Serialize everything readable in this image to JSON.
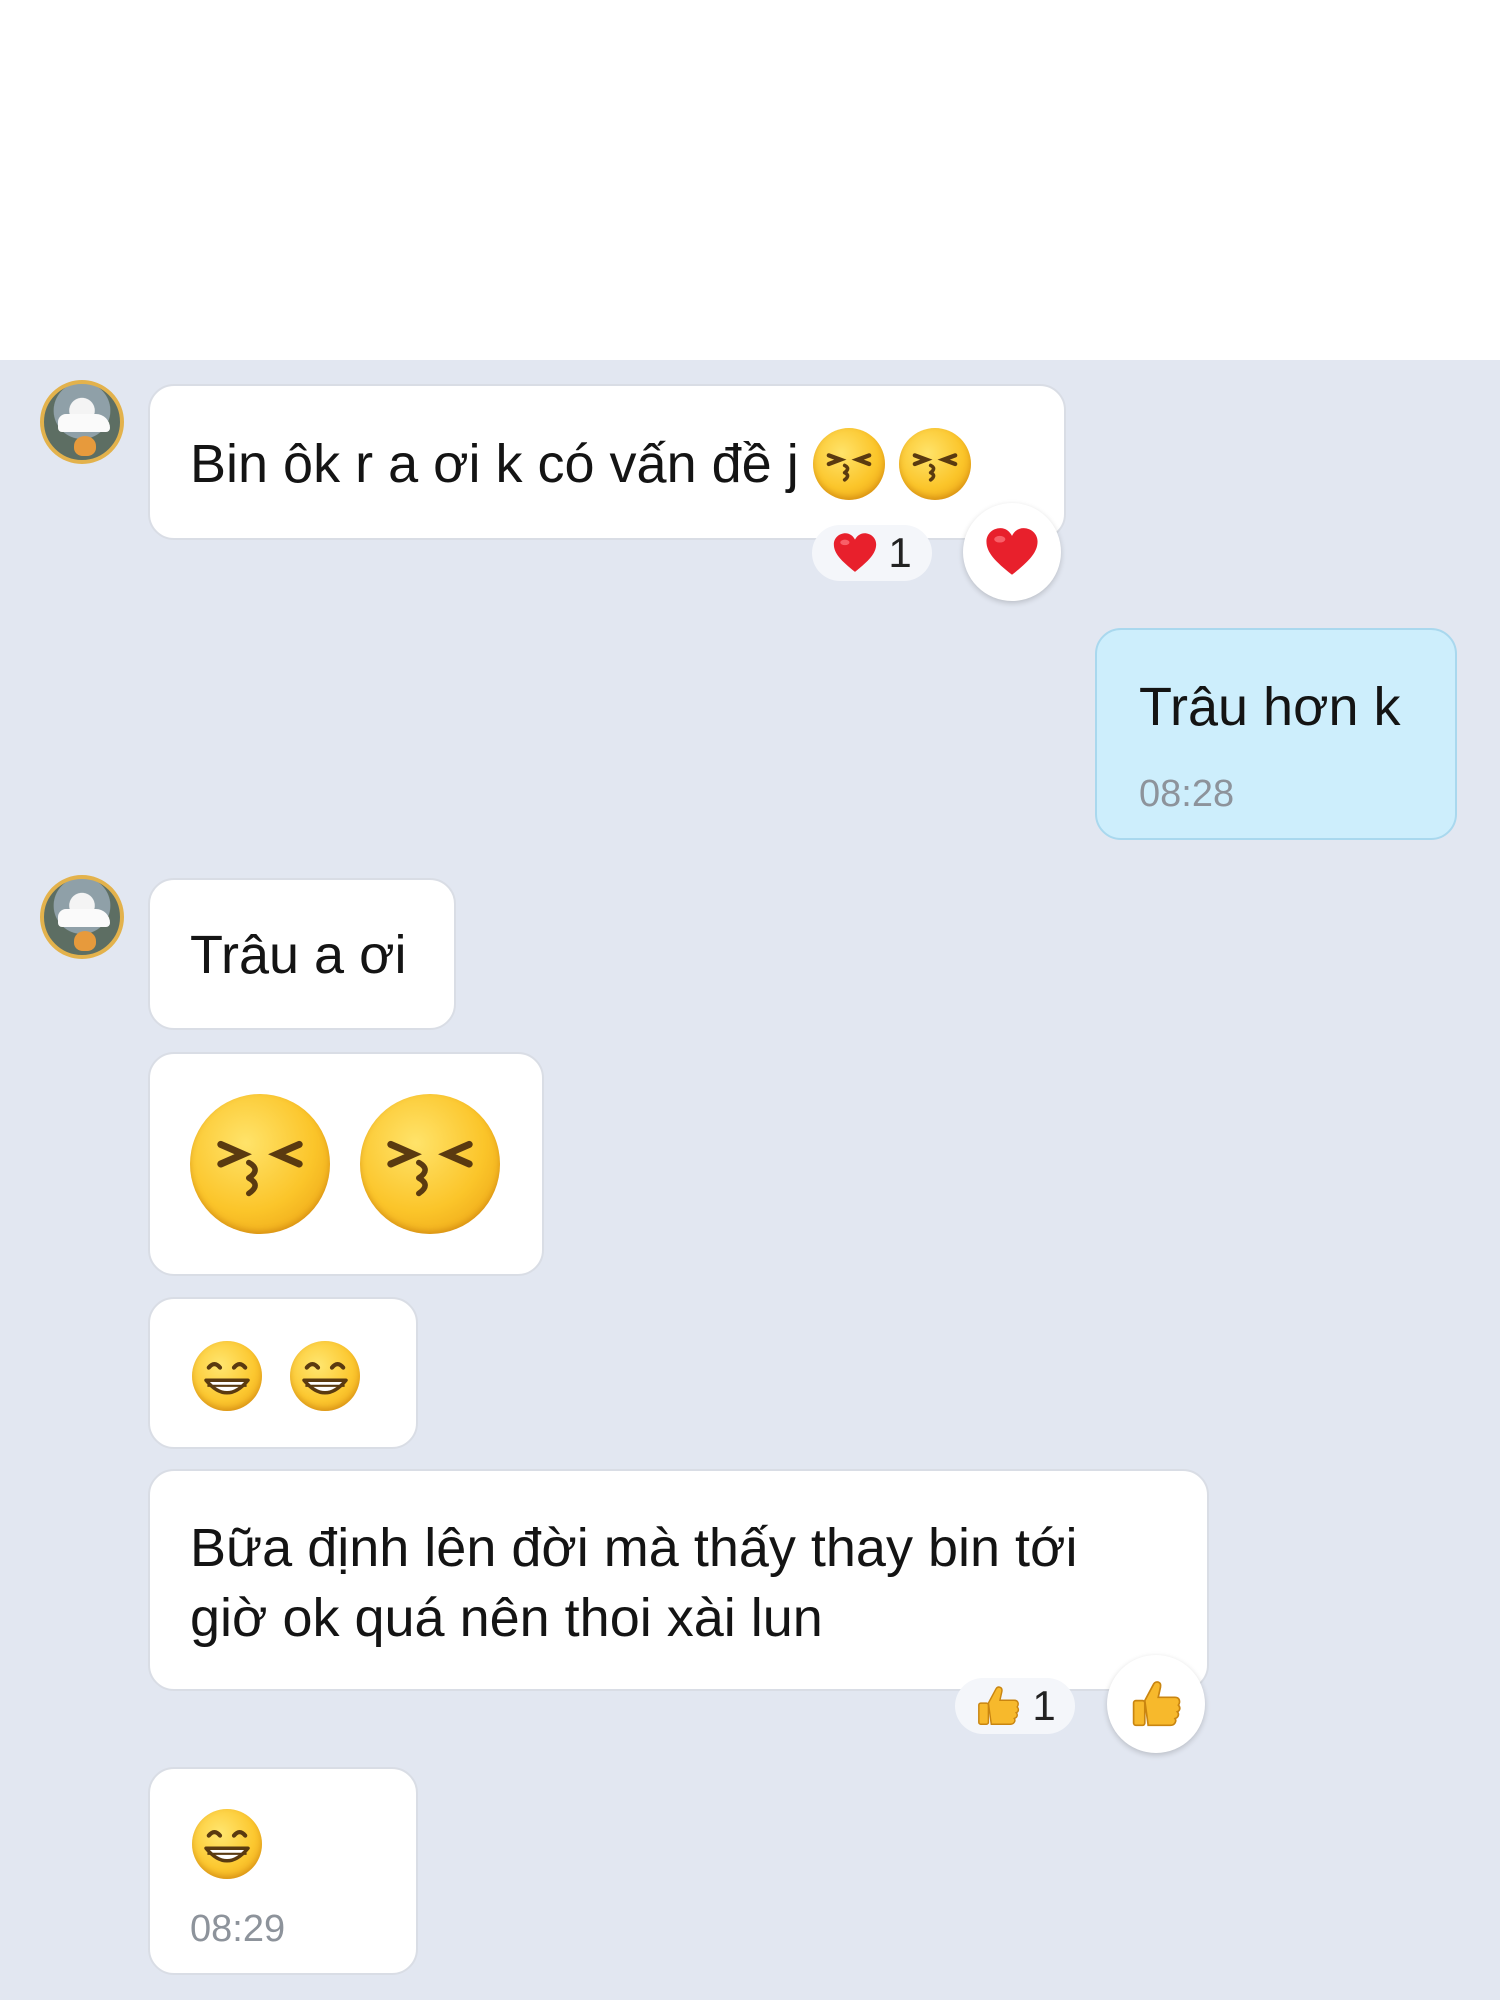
{
  "messages": [
    {
      "sender": "other",
      "text": "Bin ôk r a ơi k có vấn đề j",
      "reaction": {
        "icon": "heart-icon",
        "count": "1"
      }
    },
    {
      "sender": "me",
      "text": "Trâu hơn k",
      "time": "08:28"
    },
    {
      "sender": "other",
      "text": "Trâu a ơi"
    },
    {
      "sender": "other",
      "emojis": [
        "kissing-face-icon",
        "kissing-face-icon"
      ]
    },
    {
      "sender": "other",
      "emojis": [
        "grinning-face-icon",
        "grinning-face-icon"
      ]
    },
    {
      "sender": "other",
      "text_line1": "Bữa định lên đời mà thấy thay bin tới",
      "text_line2": "giờ ok quá nên thoi xài lun",
      "reaction": {
        "icon": "thumbs-up-icon",
        "count": "1"
      }
    },
    {
      "sender": "other",
      "emojis": [
        "grinning-face-icon"
      ],
      "time": "08:29"
    }
  ],
  "colors": {
    "chat_background": "#e2e7f1",
    "my_bubble": "#cdeefc",
    "other_bubble": "#ffffff",
    "heart": "#e8202c",
    "emoji_yellow": "#fbc52a"
  }
}
